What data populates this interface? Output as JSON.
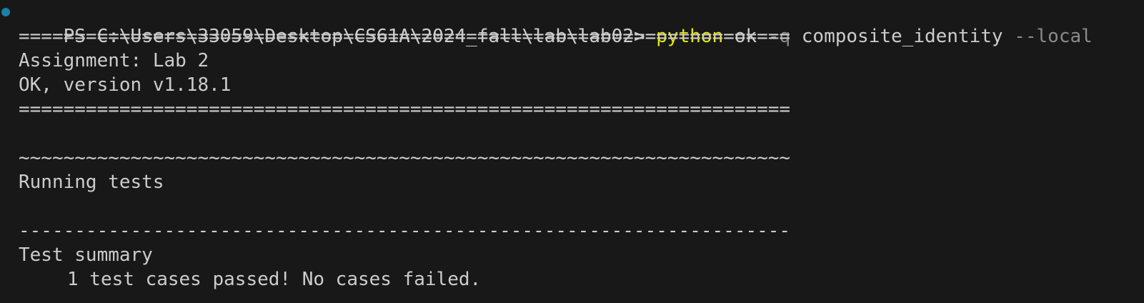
{
  "terminal": {
    "prompt": "PS C:\\Users\\33059\\Desktop\\CS61A\\2024_fall\\lab\\lab02> ",
    "command": {
      "name": "python",
      "arg1": "ok",
      "flag1": "-q",
      "arg2": "composite_identity",
      "flag2": "--local"
    },
    "output": {
      "separator_eq": "=====================================================================",
      "assignment": "Assignment: Lab 2",
      "version": "OK, version v1.18.1",
      "separator_tilde": "~~~~~~~~~~~~~~~~~~~~~~~~~~~~~~~~~~~~~~~~~~~~~~~~~~~~~~~~~~~~~~~~~~~~~",
      "running": "Running tests",
      "separator_dash": "---------------------------------------------------------------------",
      "summary": "Test summary",
      "result": "1 test cases passed! No cases failed."
    },
    "colors": {
      "background": "#181818",
      "text": "#cccccc",
      "command": "#e5e510",
      "flag": "#8a8a8a",
      "decorator": "#1b81a8"
    }
  }
}
